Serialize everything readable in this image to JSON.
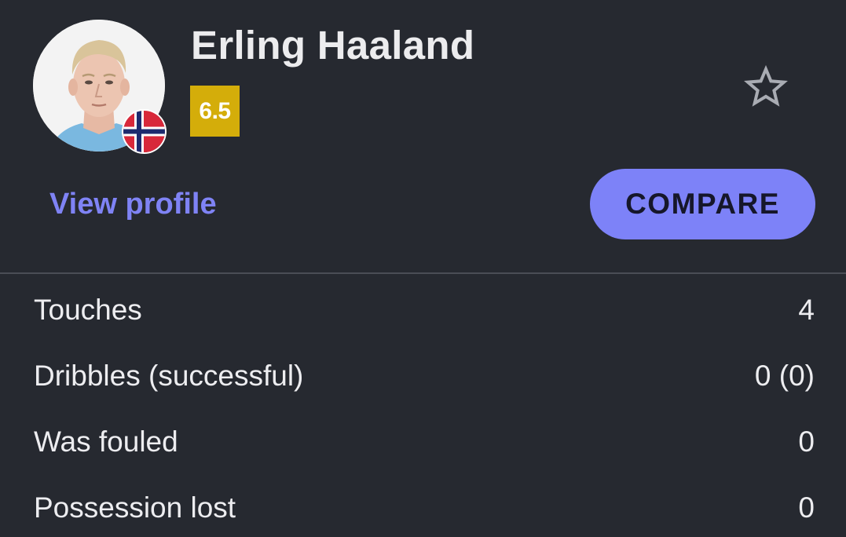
{
  "player": {
    "name": "Erling Haaland",
    "rating": "6.5",
    "nationality_flag_icon": "norway-flag-icon",
    "avatar_icon": "player-photo"
  },
  "actions": {
    "view_profile_label": "View profile",
    "compare_label": "COMPARE",
    "favorite_icon": "star-outline-icon"
  },
  "colors": {
    "background": "#262930",
    "rating_badge": "#d4ad0a",
    "accent": "#7f83f5",
    "compare_button": "#7d82f8"
  },
  "stats": [
    {
      "label": "Touches",
      "value": "4"
    },
    {
      "label": "Dribbles (successful)",
      "value": "0 (0)"
    },
    {
      "label": "Was fouled",
      "value": "0"
    },
    {
      "label": "Possession lost",
      "value": "0"
    }
  ]
}
